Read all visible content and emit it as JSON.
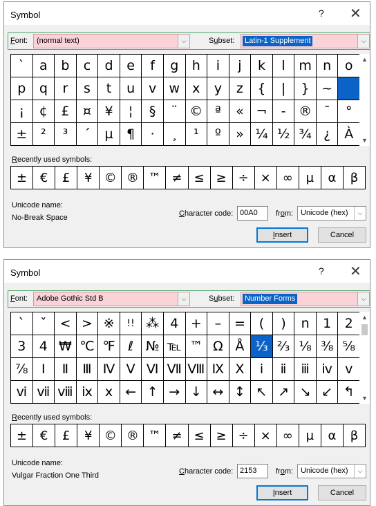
{
  "dialogs": [
    {
      "title": "Symbol",
      "help": "?",
      "close": "✕",
      "font_label": "Font:",
      "font_value": "(normal text)",
      "subset_label": "Subset:",
      "subset_value": "Latin-1 Supplement",
      "symbols": [
        "`",
        "a",
        "b",
        "c",
        "d",
        "e",
        "f",
        "g",
        "h",
        "i",
        "j",
        "k",
        "l",
        "m",
        "n",
        "o",
        "p",
        "q",
        "r",
        "s",
        "t",
        "u",
        "v",
        "w",
        "x",
        "y",
        "z",
        "{",
        "|",
        "}",
        "~",
        "",
        "¡",
        "¢",
        "£",
        "¤",
        "¥",
        "¦",
        "§",
        "¨",
        "©",
        "ª",
        "«",
        "¬",
        "-",
        "®",
        "¯",
        "°",
        "±",
        "²",
        "³",
        "´",
        "µ",
        "¶",
        "·",
        "¸",
        "¹",
        "º",
        "»",
        "¼",
        "½",
        "¾",
        "¿",
        "À"
      ],
      "selected_index": 31,
      "recent_label": "Recently used symbols:",
      "recent": [
        "±",
        "€",
        "£",
        "¥",
        "©",
        "®",
        "™",
        "≠",
        "≤",
        "≥",
        "÷",
        "×",
        "∞",
        "µ",
        "α",
        "β"
      ],
      "unicode_name_label": "Unicode name:",
      "unicode_name": "No-Break Space",
      "char_code_label": "Character code:",
      "char_code": "00A0",
      "from_label": "from:",
      "from_value": "Unicode (hex)",
      "insert": "Insert",
      "cancel": "Cancel"
    },
    {
      "title": "Symbol",
      "help": "?",
      "close": "✕",
      "font_label": "Font:",
      "font_value": "Adobe Gothic Std B",
      "subset_label": "Subset:",
      "subset_value": "Number Forms",
      "symbols": [
        "`",
        "ˇ",
        "<",
        ">",
        "※",
        "!!",
        "⁂",
        "4",
        "+",
        "–",
        "=",
        "(",
        ")",
        "n",
        "1",
        "2",
        "3",
        "4",
        "₩",
        "℃",
        "℉",
        "ℓ",
        "№",
        "℡",
        "™",
        "Ω",
        "Å",
        "⅓",
        "⅔",
        "⅛",
        "⅜",
        "⅝",
        "⅞",
        "Ⅰ",
        "Ⅱ",
        "Ⅲ",
        "Ⅳ",
        "Ⅴ",
        "Ⅵ",
        "Ⅶ",
        "Ⅷ",
        "Ⅸ",
        "Ⅹ",
        "ⅰ",
        "ⅱ",
        "ⅲ",
        "ⅳ",
        "ⅴ",
        "ⅵ",
        "ⅶ",
        "ⅷ",
        "ⅸ",
        "ⅹ",
        "←",
        "↑",
        "→",
        "↓",
        "↔",
        "↕",
        "↖",
        "↗",
        "↘",
        "↙",
        "↰"
      ],
      "selected_index": 27,
      "recent_label": "Recently used symbols:",
      "recent": [
        "±",
        "€",
        "£",
        "¥",
        "©",
        "®",
        "™",
        "≠",
        "≤",
        "≥",
        "÷",
        "×",
        "∞",
        "µ",
        "α",
        "β"
      ],
      "unicode_name_label": "Unicode name:",
      "unicode_name": "Vulgar Fraction One Third",
      "char_code_label": "Character code:",
      "char_code": "2153",
      "from_label": "from:",
      "from_value": "Unicode (hex)",
      "insert": "Insert",
      "cancel": "Cancel"
    }
  ]
}
